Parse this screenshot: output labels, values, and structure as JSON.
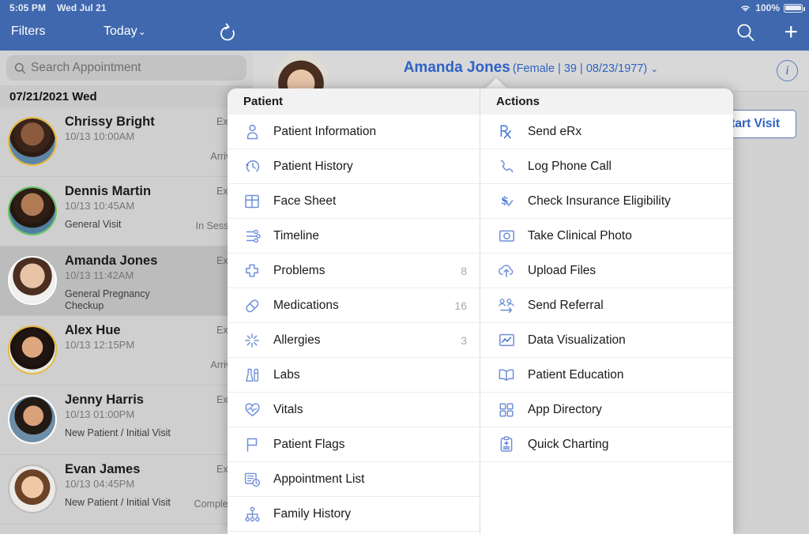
{
  "status_bar": {
    "time": "5:05 PM",
    "date": "Wed Jul 21",
    "battery_percent": "100%",
    "wifi_icon": "wifi-icon",
    "battery_icon": "battery-full-icon"
  },
  "navbar": {
    "filters_label": "Filters",
    "today_label": "Today",
    "today_chevron": "⌄",
    "refresh_icon": "refresh-icon",
    "search_icon": "search-icon",
    "add_icon": "plus-icon",
    "background_color": "#3f68ae"
  },
  "search": {
    "placeholder": "Search Appointment",
    "icon": "search-icon"
  },
  "appointments": {
    "date_header": "07/21/2021 Wed",
    "rows": [
      {
        "name": "Chrissy Bright",
        "time": "10/13 10:00AM",
        "reason": "",
        "type": "Exam",
        "status": "Arrived",
        "ring_color": "#e8b93a",
        "selected": false
      },
      {
        "name": "Dennis Martin",
        "time": "10/13 10:45AM",
        "reason": "General Visit",
        "type": "Exam",
        "status": "In Session",
        "ring_color": "#5fc45f",
        "selected": false
      },
      {
        "name": "Amanda Jones",
        "time": "10/13 11:42AM",
        "reason": "General Pregnancy Checkup",
        "type": "Exam",
        "status": "",
        "ring_color": "#ffffff",
        "selected": true
      },
      {
        "name": "Alex Hue",
        "time": "10/13 12:15PM",
        "reason": "",
        "type": "Exam",
        "status": "Arrived",
        "ring_color": "#e8b93a",
        "selected": false
      },
      {
        "name": "Jenny Harris",
        "time": "10/13 01:00PM",
        "reason": "New Patient / Initial Visit",
        "type": "Exam",
        "status": "",
        "ring_color": "#ffffff",
        "selected": false
      },
      {
        "name": "Evan James",
        "time": "10/13 04:45PM",
        "reason": "New Patient / Initial Visit",
        "type": "Exam",
        "status": "Completed",
        "ring_color": "#bdbdbd",
        "selected": false
      }
    ]
  },
  "patient_header": {
    "name": "Amanda Jones",
    "meta": "(Female | 39 | 08/23/1977)",
    "chevron": "⌄",
    "info_icon": "info-icon",
    "avatar_icon": "patient-avatar",
    "accent_color": "#2e62c4"
  },
  "start_visit": {
    "label": "Start Visit"
  },
  "popover": {
    "patient_column": {
      "title": "Patient",
      "items": [
        {
          "label": "Patient Information",
          "icon": "person-icon",
          "count": ""
        },
        {
          "label": "Patient History",
          "icon": "clock-back-icon",
          "count": ""
        },
        {
          "label": "Face Sheet",
          "icon": "grid-sheet-icon",
          "count": ""
        },
        {
          "label": "Timeline",
          "icon": "timeline-icon",
          "count": ""
        },
        {
          "label": "Problems",
          "icon": "medical-cross-icon",
          "count": "8"
        },
        {
          "label": "Medications",
          "icon": "pill-icon",
          "count": "16"
        },
        {
          "label": "Allergies",
          "icon": "allergy-burst-icon",
          "count": "3"
        },
        {
          "label": "Labs",
          "icon": "lab-flask-icon",
          "count": ""
        },
        {
          "label": "Vitals",
          "icon": "heart-pulse-icon",
          "count": ""
        },
        {
          "label": "Patient Flags",
          "icon": "flag-icon",
          "count": ""
        },
        {
          "label": "Appointment List",
          "icon": "appointment-list-icon",
          "count": ""
        },
        {
          "label": "Family History",
          "icon": "family-tree-icon",
          "count": ""
        }
      ]
    },
    "actions_column": {
      "title": "Actions",
      "items": [
        {
          "label": "Send eRx",
          "icon": "rx-icon"
        },
        {
          "label": "Log Phone Call",
          "icon": "phone-icon"
        },
        {
          "label": "Check Insurance Eligibility",
          "icon": "dollar-check-icon"
        },
        {
          "label": "Take Clinical Photo",
          "icon": "camera-icon"
        },
        {
          "label": "Upload Files",
          "icon": "cloud-upload-icon"
        },
        {
          "label": "Send Referral",
          "icon": "referral-icon"
        },
        {
          "label": "Data Visualization",
          "icon": "chart-icon"
        },
        {
          "label": "Patient Education",
          "icon": "book-icon"
        },
        {
          "label": "App Directory",
          "icon": "apps-grid-icon"
        },
        {
          "label": "Quick Charting",
          "icon": "clipboard-icon"
        }
      ]
    }
  },
  "colors": {
    "brand_blue": "#3f68ae",
    "link_blue": "#2e62c4",
    "icon_blue": "#6f8fd8",
    "panel_gray": "#d0d0d0"
  }
}
